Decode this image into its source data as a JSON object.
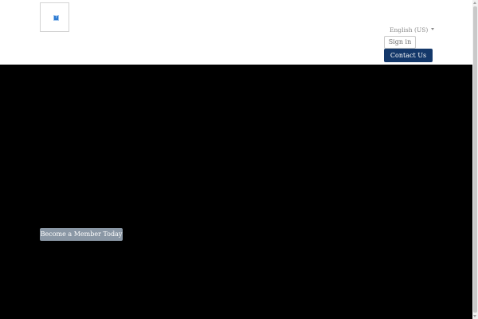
{
  "header": {
    "logo_icon": "broken-image-icon",
    "language_selector": "English (US)",
    "sign_in": "Sign in",
    "contact_us": "Contact Us"
  },
  "hero": {
    "cta_label": "Become a Member Today"
  },
  "colors": {
    "primary_button": "#14386a",
    "hero_background": "#000000",
    "cta_button": "#8a97a5"
  }
}
